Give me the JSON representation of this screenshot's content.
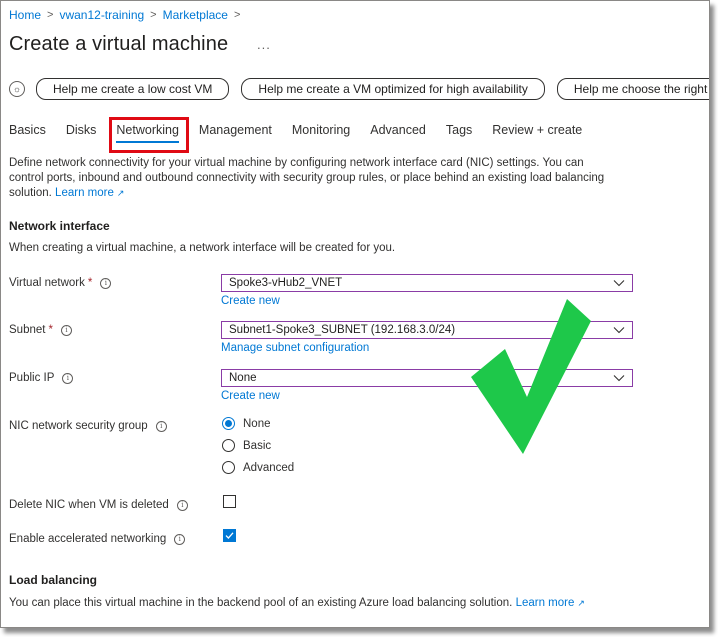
{
  "breadcrumb": [
    "Home",
    "vwan12-training",
    "Marketplace"
  ],
  "page_title": "Create a virtual machine",
  "more_label": "...",
  "helpers": [
    "Help me create a low cost VM",
    "Help me create a VM optimized for high availability",
    "Help me choose the right V"
  ],
  "tabs": [
    {
      "label": "Basics"
    },
    {
      "label": "Disks"
    },
    {
      "label": "Networking",
      "active": true
    },
    {
      "label": "Management"
    },
    {
      "label": "Monitoring"
    },
    {
      "label": "Advanced"
    },
    {
      "label": "Tags"
    },
    {
      "label": "Review + create"
    }
  ],
  "description": {
    "text": "Define network connectivity for your virtual machine by configuring network interface card (NIC) settings. You can control ports, inbound and outbound connectivity with security group rules, or place behind an existing load balancing solution.",
    "link": "Learn more"
  },
  "network_interface": {
    "heading": "Network interface",
    "intro": "When creating a virtual machine, a network interface will be created for you.",
    "virtual_network": {
      "label": "Virtual network",
      "value": "Spoke3-vHub2_VNET",
      "link": "Create new"
    },
    "subnet": {
      "label": "Subnet",
      "value": "Subnet1-Spoke3_SUBNET (192.168.3.0/24)",
      "link": "Manage subnet configuration"
    },
    "public_ip": {
      "label": "Public IP",
      "value": "None",
      "link": "Create new"
    },
    "nsg": {
      "label": "NIC network security group",
      "options": [
        "None",
        "Basic",
        "Advanced"
      ],
      "selected": "None"
    },
    "delete_nic": {
      "label": "Delete NIC when VM is deleted",
      "checked": false
    },
    "accelerated": {
      "label": "Enable accelerated networking",
      "checked": true
    }
  },
  "load_balancing": {
    "heading": "Load balancing",
    "text": "You can place this virtual machine in the backend pool of an existing Azure load balancing solution.",
    "link": "Learn more"
  },
  "required_marker": "*",
  "colors": {
    "accent": "#0078d4",
    "highlight": "#e00a14",
    "check_overlay": "#1ec84a"
  }
}
